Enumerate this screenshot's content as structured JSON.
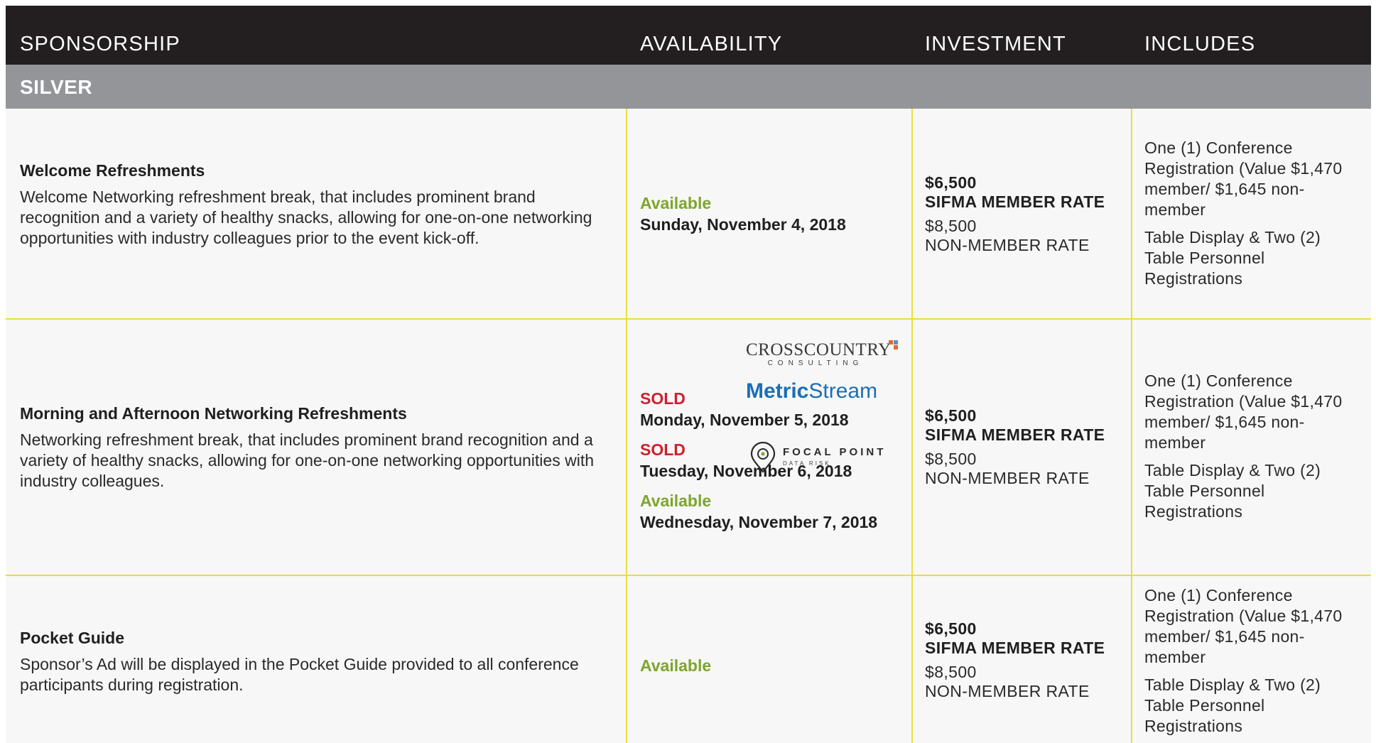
{
  "header": {
    "col_sponsorship": "SPONSORSHIP",
    "col_availability": "AVAILABILITY",
    "col_investment": "INVESTMENT",
    "col_includes": "INCLUDES"
  },
  "tier": {
    "label": "SILVER"
  },
  "rows": [
    {
      "title": "Welcome Refreshments",
      "description": "Welcome Networking refreshment break, that includes prominent brand recognition and a variety of healthy snacks, allowing for one-on-one networking opportunities with industry colleagues prior to the event kick-off.",
      "availability": [
        {
          "status": "Available",
          "date": "Sunday, November 4, 2018"
        }
      ],
      "member_price": "$6,500",
      "member_label": "SIFMA MEMBER RATE",
      "nonmember_price": "$8,500",
      "nonmember_label": "NON-MEMBER RATE",
      "includes": [
        "One (1) Conference Registration (Value $1,470 member/ $1,645 non-member",
        "Table Display & Two (2) Table Personnel Registrations"
      ]
    },
    {
      "title": "Morning and Afternoon Networking Refreshments",
      "description": "Networking refreshment break, that includes prominent brand recognition and a variety of healthy snacks, allowing for one-on-one networking opportunities with industry colleagues.",
      "availability": [
        {
          "status": "SOLD",
          "date": "Monday, November 5, 2018"
        },
        {
          "status": "SOLD",
          "date": "Tuesday, November 6, 2018"
        },
        {
          "status": "Available",
          "date": "Wednesday, November 7, 2018"
        }
      ],
      "logos": {
        "crosscountry_main": "CROSSCOUNTRY",
        "crosscountry_sub": "CONSULTING",
        "metric": "Metric",
        "stream": "Stream",
        "focal_main": "FOCAL POINT",
        "focal_sub": "DATA RISK"
      },
      "member_price": "$6,500",
      "member_label": "SIFMA MEMBER RATE",
      "nonmember_price": "$8,500",
      "nonmember_label": "NON-MEMBER RATE",
      "includes": [
        "One (1) Conference Registration (Value $1,470 member/ $1,645 non-member",
        "Table Display & Two (2) Table Personnel Registrations"
      ]
    },
    {
      "title": "Pocket Guide",
      "description": "Sponsor’s Ad will be displayed in the Pocket Guide provided to all conference participants during registration.",
      "availability": [
        {
          "status": "Available"
        }
      ],
      "member_price": "$6,500",
      "member_label": "SIFMA MEMBER RATE",
      "nonmember_price": "$8,500",
      "nonmember_label": "NON-MEMBER RATE",
      "includes": [
        "One (1) Conference Registration (Value $1,470 member/ $1,645 non-member",
        "Table Display & Two (2) Table Personnel Registrations"
      ]
    }
  ],
  "colors": {
    "header_bg": "#231f20",
    "tier_bg": "#949599",
    "grid_line": "#e8df3c",
    "available": "#7ea52d",
    "sold": "#cf1f2e",
    "metric_blue": "#1a6fb5"
  }
}
